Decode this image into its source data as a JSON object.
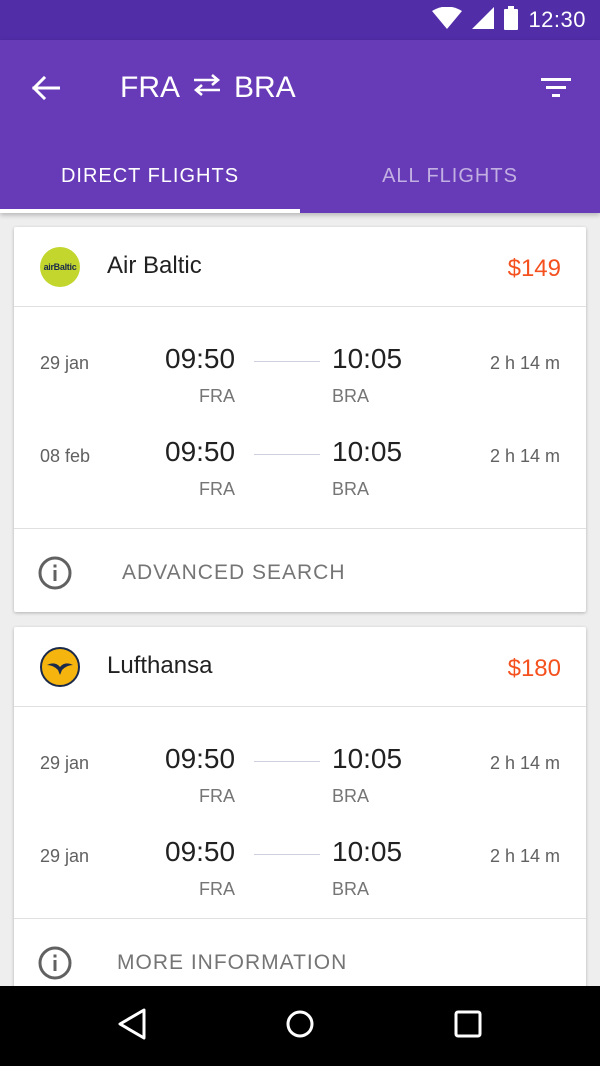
{
  "status_bar": {
    "time": "12:30",
    "icons": [
      "wifi-icon",
      "signal-icon",
      "battery-icon"
    ]
  },
  "app_bar": {
    "origin": "FRA",
    "destination": "BRA",
    "icons": [
      "back-arrow-icon",
      "swap-icon",
      "filter-icon"
    ]
  },
  "tabs": [
    {
      "label": "DIRECT FLIGHTS",
      "active": true
    },
    {
      "label": "ALL FLIGHTS",
      "active": false
    }
  ],
  "cards": [
    {
      "airline": "Air Baltic",
      "logo_text": "airBaltic",
      "price": "$149",
      "flights": [
        {
          "date": "29 jan",
          "dep_time": "09:50",
          "dep_code": "FRA",
          "arr_time": "10:05",
          "arr_code": "BRA",
          "duration": "2 h 14 m"
        },
        {
          "date": "08 feb",
          "dep_time": "09:50",
          "dep_code": "FRA",
          "arr_time": "10:05",
          "arr_code": "BRA",
          "duration": "2 h 14 m"
        }
      ],
      "footer_label": "ADVANCED SEARCH"
    },
    {
      "airline": "Lufthansa",
      "price": "$180",
      "flights": [
        {
          "date": "29 jan",
          "dep_time": "09:50",
          "dep_code": "FRA",
          "arr_time": "10:05",
          "arr_code": "BRA",
          "duration": "2 h 14 m"
        },
        {
          "date": "29 jan",
          "dep_time": "09:50",
          "dep_code": "FRA",
          "arr_time": "10:05",
          "arr_code": "BRA",
          "duration": "2 h 14 m"
        }
      ],
      "footer_label": "MORE INFORMATION"
    }
  ],
  "nav_bar": {
    "icons": [
      "back-triangle-icon",
      "home-circle-icon",
      "recents-square-icon"
    ]
  },
  "colors": {
    "primary": "#673ab7",
    "primary_dark": "#512da8",
    "price": "#f4511e",
    "air_baltic_logo": "#c2d62e",
    "lufthansa_logo": "#f6b40e"
  }
}
